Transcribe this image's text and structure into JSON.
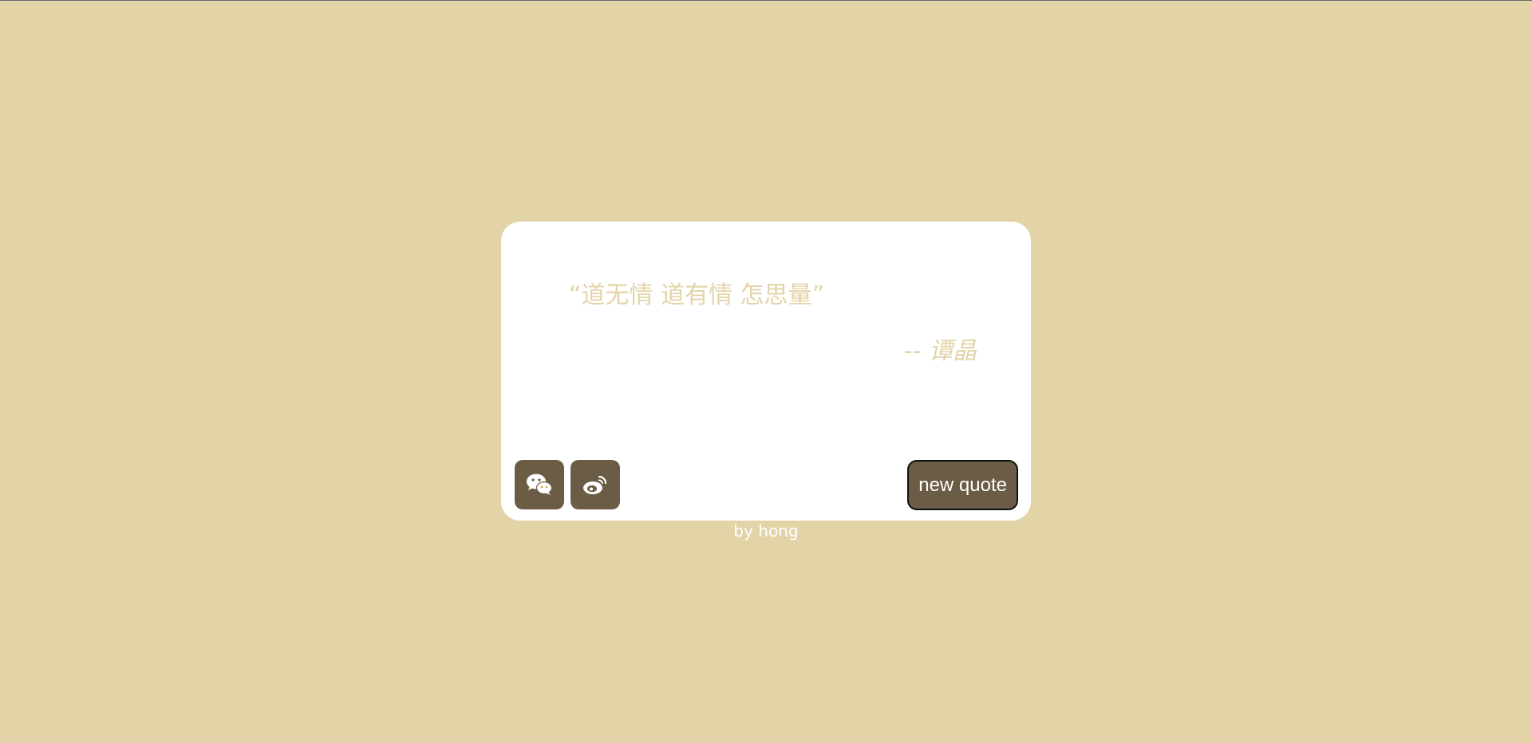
{
  "quote": {
    "text": "“道无情 道有情 怎思量”",
    "author": "-- 谭晶"
  },
  "actions": {
    "wechat_icon": "wechat-icon",
    "weibo_icon": "weibo-icon",
    "new_quote_label": "new quote"
  },
  "footer": {
    "credit": "by hong"
  },
  "colors": {
    "background": "#e3d4a8",
    "card": "#ffffff",
    "accent": "#6b5c45",
    "quote_text": "#e3d4a8"
  }
}
